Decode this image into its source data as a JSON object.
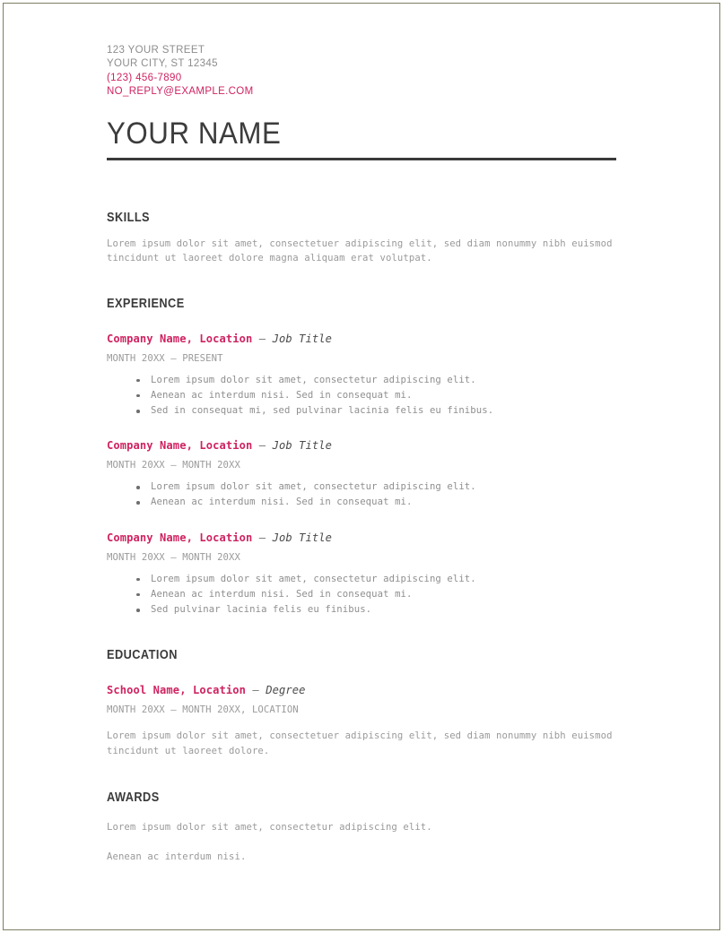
{
  "contact": {
    "street": "123 YOUR STREET",
    "city_state_zip": "YOUR CITY, ST 12345",
    "phone": "(123) 456-7890",
    "email": "NO_REPLY@EXAMPLE.COM"
  },
  "name": "YOUR NAME",
  "accent_color": "#cf2361",
  "text_color": "#3a3a3a",
  "body_color": "#9a9a9a",
  "border_color": "#7d7f63",
  "sections": {
    "skills": {
      "title": "SKILLS",
      "body": "Lorem ipsum dolor sit amet, consectetuer adipiscing elit, sed diam nonummy nibh euismod tincidunt ut laoreet dolore magna aliquam erat volutpat."
    },
    "experience": {
      "title": "EXPERIENCE",
      "entries": [
        {
          "org": "Company Name, Location",
          "dash": "—",
          "role": "Job Title",
          "date": "MONTH 20XX – PRESENT",
          "bullets": [
            "Lorem ipsum dolor sit amet, consectetur adipiscing elit.",
            "Aenean ac interdum nisi. Sed in consequat mi.",
            "Sed in consequat mi, sed pulvinar lacinia felis eu finibus."
          ]
        },
        {
          "org": "Company Name, Location",
          "dash": "—",
          "role": "Job Title",
          "date": "MONTH 20XX – MONTH 20XX",
          "bullets": [
            "Lorem ipsum dolor sit amet, consectetur adipiscing elit.",
            "Aenean ac interdum nisi. Sed in consequat mi."
          ]
        },
        {
          "org": "Company Name, Location",
          "dash": "—",
          "role": "Job Title",
          "date": "MONTH 20XX – MONTH 20XX",
          "bullets": [
            "Lorem ipsum dolor sit amet, consectetur adipiscing elit.",
            "Aenean ac interdum nisi. Sed in consequat mi.",
            "Sed pulvinar lacinia felis eu finibus."
          ]
        }
      ]
    },
    "education": {
      "title": "EDUCATION",
      "entry": {
        "org": "School Name, Location",
        "dash": "—",
        "role": "Degree",
        "date": "MONTH 20XX – MONTH 20XX, LOCATION",
        "body": "Lorem ipsum dolor sit amet, consectetuer adipiscing elit, sed diam nonummy nibh euismod tincidunt ut laoreet dolore."
      }
    },
    "awards": {
      "title": "AWARDS",
      "lines": [
        "Lorem ipsum dolor sit amet, consectetur adipiscing elit.",
        "Aenean ac interdum nisi."
      ]
    }
  }
}
